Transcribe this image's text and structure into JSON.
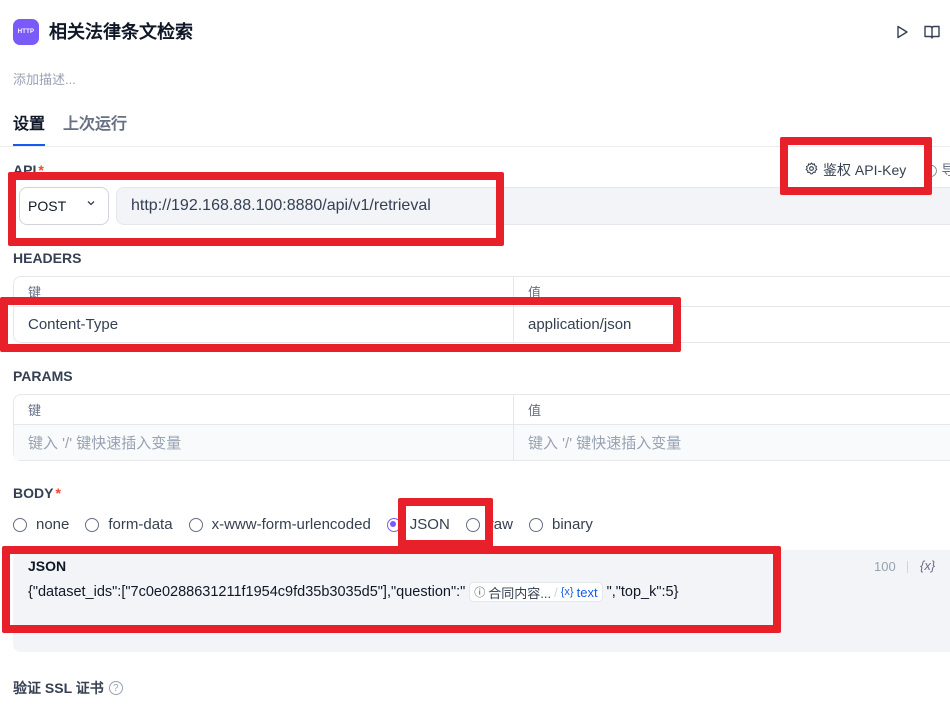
{
  "header": {
    "icon_text": "HTTP",
    "title": "相关法律条文检索",
    "description_placeholder": "添加描述..."
  },
  "tabs": [
    {
      "label": "设置",
      "active": true
    },
    {
      "label": "上次运行",
      "active": false
    }
  ],
  "api": {
    "label": "API",
    "required_mark": "*",
    "auth_button": "鉴权 API-Key",
    "import_button_partial": "导",
    "method": "POST",
    "url": "http://192.168.88.100:8880/api/v1/retrieval"
  },
  "headers": {
    "label": "HEADERS",
    "col_key": "键",
    "col_value": "值",
    "rows": [
      {
        "key": "Content-Type",
        "value": "application/json"
      }
    ]
  },
  "params": {
    "label": "PARAMS",
    "col_key": "键",
    "col_value": "值",
    "key_placeholder": "键入 '/' 键快速插入变量",
    "value_placeholder": "键入 '/' 键快速插入变量"
  },
  "body": {
    "label": "BODY",
    "required_mark": "*",
    "options": [
      "none",
      "form-data",
      "x-www-form-urlencoded",
      "JSON",
      "raw",
      "binary"
    ],
    "selected": "JSON"
  },
  "json_editor": {
    "label": "JSON",
    "char_count": "100",
    "var_button": "{x}",
    "code_before": "{\"dataset_ids\":[\"7c0e0288631211f1954c9fd35b3035d5\"],\"question\":\"",
    "chip_node": "合同内容...",
    "chip_var": "text",
    "code_after": "\",\"top_k\":5}"
  },
  "ssl": {
    "label": "验证 SSL 证书"
  },
  "colors": {
    "accent": "#155aef",
    "node_icon": "#7a5af8",
    "highlight": "#e8202a"
  }
}
